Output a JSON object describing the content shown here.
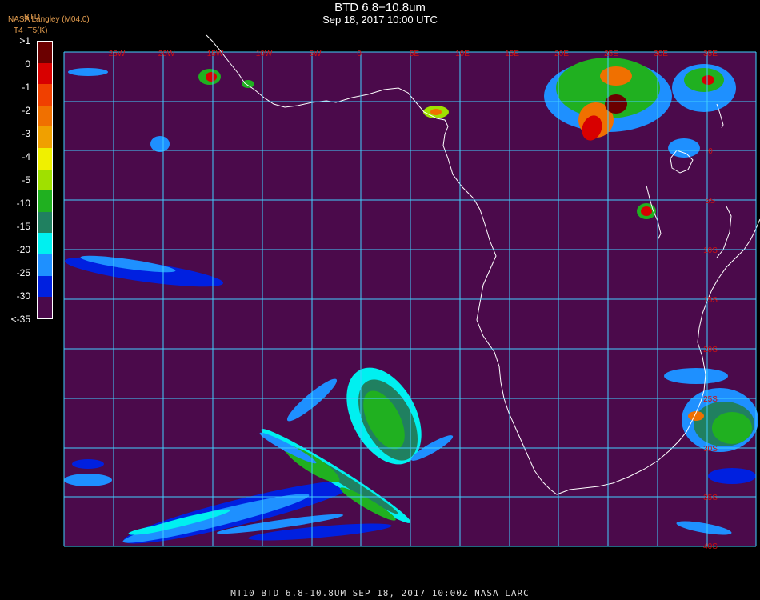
{
  "header": {
    "title": "BTD 6.8−10.8um",
    "subtitle": "Sep 18, 2017 10:00 UTC",
    "credit": "NASA Langley (M04.0)",
    "unit_top": "BTD",
    "unit": "T4−T5(K)"
  },
  "legend": {
    "labels": [
      ">1",
      "0",
      "-1",
      "-2",
      "-3",
      "-4",
      "-5",
      "-10",
      "-15",
      "-20",
      "-25",
      "-30",
      "<-35"
    ],
    "colors": [
      "#6b0000",
      "#d80000",
      "#f04000",
      "#f07000",
      "#f0a000",
      "#f0f000",
      "#a0e000",
      "#20b020",
      "#208060",
      "#00f0f0",
      "#1e90ff",
      "#0020e0",
      "#4b0a4b"
    ]
  },
  "map": {
    "background_color": "#4b0a4b",
    "grid_color": "#40d0ff",
    "lon_labels": [
      "25W",
      "20W",
      "15W",
      "10W",
      "5W",
      "0",
      "5E",
      "10E",
      "15E",
      "20E",
      "25E",
      "30E",
      "35E"
    ],
    "lat_labels": [
      "0",
      "5S",
      "10S",
      "15S",
      "20S",
      "25S",
      "30S",
      "35S",
      "40S"
    ],
    "label_color": "#d01010"
  },
  "footer": {
    "text": "MT10  BTD 6.8-10.8UM   SEP 18, 2017 10:00Z   NASA LARC"
  }
}
